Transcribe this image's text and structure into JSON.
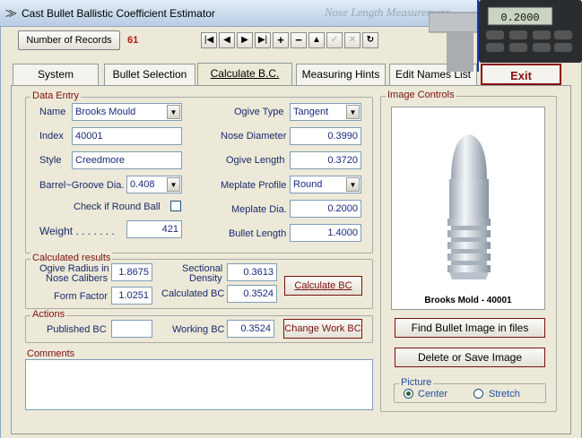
{
  "window": {
    "title": "Cast Bullet Ballistic Coefficient Estimator",
    "watermark": "Nose Length Measurement"
  },
  "toolbar": {
    "records_label": "Number of Records",
    "records_count": "61",
    "nav_buttons": [
      {
        "icon": "first-record-icon",
        "glyph": "|◀"
      },
      {
        "icon": "prev-record-icon",
        "glyph": "◀"
      },
      {
        "icon": "next-record-icon",
        "glyph": "▶"
      },
      {
        "icon": "last-record-icon",
        "glyph": "▶|"
      },
      {
        "icon": "add-record-icon",
        "glyph": "+"
      },
      {
        "icon": "delete-record-icon",
        "glyph": "−"
      },
      {
        "icon": "edit-record-icon",
        "glyph": "▲"
      },
      {
        "icon": "save-record-icon",
        "glyph": "✓"
      },
      {
        "icon": "cancel-edit-icon",
        "glyph": "✕"
      },
      {
        "icon": "refresh-icon",
        "glyph": "↻"
      }
    ]
  },
  "tabs": [
    {
      "label": "System"
    },
    {
      "label": "Bullet Selection"
    },
    {
      "label": "Calculate B.C."
    },
    {
      "label": "Measuring Hints"
    },
    {
      "label": "Edit Names List"
    },
    {
      "label": "Exit"
    }
  ],
  "caliper": {
    "display": "0.2000"
  },
  "data_entry": {
    "legend": "Data Entry",
    "name_label": "Name",
    "name_value": "Brooks Mould",
    "index_label": "Index",
    "index_value": "40001",
    "style_label": "Style",
    "style_value": "Creedmore",
    "barrel_label": "Barrel~Groove Dia.",
    "barrel_value": "0.408",
    "round_ball_label": "Check if Round Ball",
    "weight_label": "Weight . . . . . . .",
    "weight_value": "421",
    "ogive_type_label": "Ogive Type",
    "ogive_type_value": "Tangent",
    "nose_diameter_label": "Nose Diameter",
    "nose_diameter_value": "0.3990",
    "ogive_length_label": "Ogive Length",
    "ogive_length_value": "0.3720",
    "meplate_profile_label": "Meplate Profile",
    "meplate_profile_value": "Round",
    "meplate_dia_label": "Meplate Dia.",
    "meplate_dia_value": "0.2000",
    "bullet_length_label": "Bullet Length",
    "bullet_length_value": "1.4000"
  },
  "calculated": {
    "legend": "Calculated results",
    "ogive_radius_label_1": "Ogive Radius in",
    "ogive_radius_label_2": "Nose Calibers",
    "ogive_radius_value": "1.8675",
    "form_factor_label": "Form Factor",
    "form_factor_value": "1.0251",
    "sectional_density_label_1": "Sectional",
    "sectional_density_label_2": "Density",
    "sectional_density_value": "0.3613",
    "calculated_bc_label": "Calculated BC",
    "calculated_bc_value": "0.3524",
    "calculate_button": "Calculate BC"
  },
  "actions": {
    "legend": "Actions",
    "published_bc_label": "Published BC",
    "published_bc_value": "",
    "working_bc_label": "Working BC",
    "working_bc_value": "0.3524",
    "change_button": "Change Work BC"
  },
  "comments": {
    "legend": "Comments",
    "value": ""
  },
  "image_controls": {
    "legend": "Image Controls",
    "caption": "Brooks Mold - 40001",
    "find_button": "Find Bullet Image in files",
    "delete_save_button": "Delete or Save Image",
    "picture_legend": "Picture",
    "center_label": "Center",
    "stretch_label": "Stretch",
    "selected": "Center"
  }
}
